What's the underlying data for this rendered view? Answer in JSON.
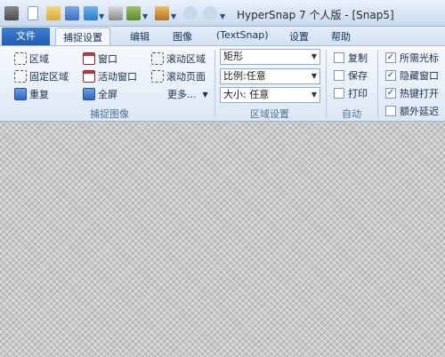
{
  "window": {
    "title": "HyperSnap 7 个人版 - [Snap5]"
  },
  "tabs": {
    "file": "文件",
    "capture_settings": "捕捉设置",
    "edit": "编辑",
    "image": "图像",
    "textsnap": "(TextSnap)",
    "settings": "设置",
    "help": "帮助"
  },
  "capture_group": {
    "region": "区域",
    "fixed_region": "固定区域",
    "repeat": "重复",
    "window": "窗口",
    "active_window": "活动窗口",
    "full_screen": "全屏",
    "scroll_region": "滚动区域",
    "scroll_page": "滚动页面",
    "more": "更多...",
    "label": "捕捉图像"
  },
  "region_group": {
    "shape": "矩形",
    "ratio": "比例:任意",
    "size": "大小: 任意",
    "label": "区域设置"
  },
  "auto_group": {
    "copy": "复制",
    "save": "保存",
    "print": "打印",
    "label": "自动"
  },
  "options_group": {
    "cursor": "所需光标",
    "hide_window": "隐藏窗口",
    "hotkey": "热键打开",
    "extra_delay": "额外延迟"
  },
  "check_states": {
    "copy": false,
    "save": false,
    "print": false,
    "cursor": true,
    "hide_window": true,
    "hotkey": true,
    "extra_delay": false
  },
  "icons": [
    "app-icon",
    "new-icon",
    "open-icon",
    "save-icon",
    "upload-icon",
    "print-icon",
    "window-icon",
    "capture-icon",
    "undo-icon",
    "redo-icon"
  ]
}
